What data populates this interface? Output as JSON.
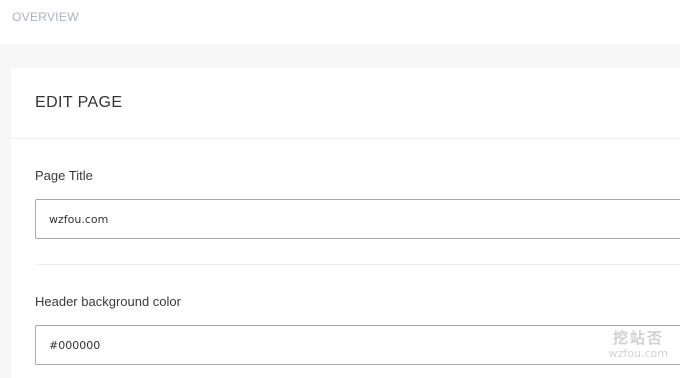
{
  "header": {
    "overview_label": "OVERVIEW"
  },
  "card": {
    "title": "EDIT PAGE",
    "fields": [
      {
        "label": "Page Title",
        "value": "wzfou.com"
      },
      {
        "label": "Header background color",
        "value": "#000000"
      }
    ]
  },
  "watermark": {
    "logo_text": "挖站否",
    "url": "wzfou.com"
  }
}
